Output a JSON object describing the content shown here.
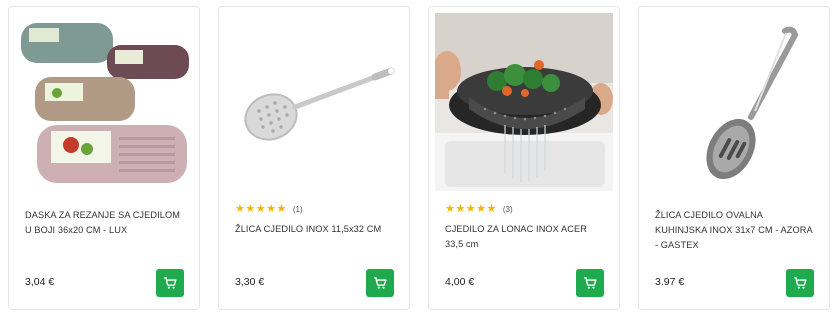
{
  "products": [
    {
      "name": "DASKA ZA REZANJE SA CJEDILOM U BOJI 36x20 CM - LUX",
      "price": "3,04 €",
      "rating": null,
      "review_count": null,
      "image_icon": "cutting-board-strainer-icon"
    },
    {
      "name": "ŽLICA CJEDILO INOX 11,5x32 CM",
      "price": "3,30 €",
      "rating": 5,
      "review_count": "(1)",
      "image_icon": "skimmer-spoon-icon"
    },
    {
      "name": "CJEDILO ZA LONAC INOX ACER 33,5 cm",
      "price": "4,00 €",
      "rating": 5,
      "review_count": "(3)",
      "image_icon": "pot-strainer-photo"
    },
    {
      "name": "ŽLICA CJEDILO OVALNA KUHINJSKA INOX 31x7 CM - AZORA - GASTEX",
      "price": "3.97 €",
      "rating": null,
      "review_count": null,
      "image_icon": "slotted-spoon-icon"
    }
  ],
  "colors": {
    "cart_button": "#1faa4e",
    "star": "#f5b400",
    "card_border": "#e6e6e6"
  },
  "cart_icon": "shopping-cart-icon"
}
